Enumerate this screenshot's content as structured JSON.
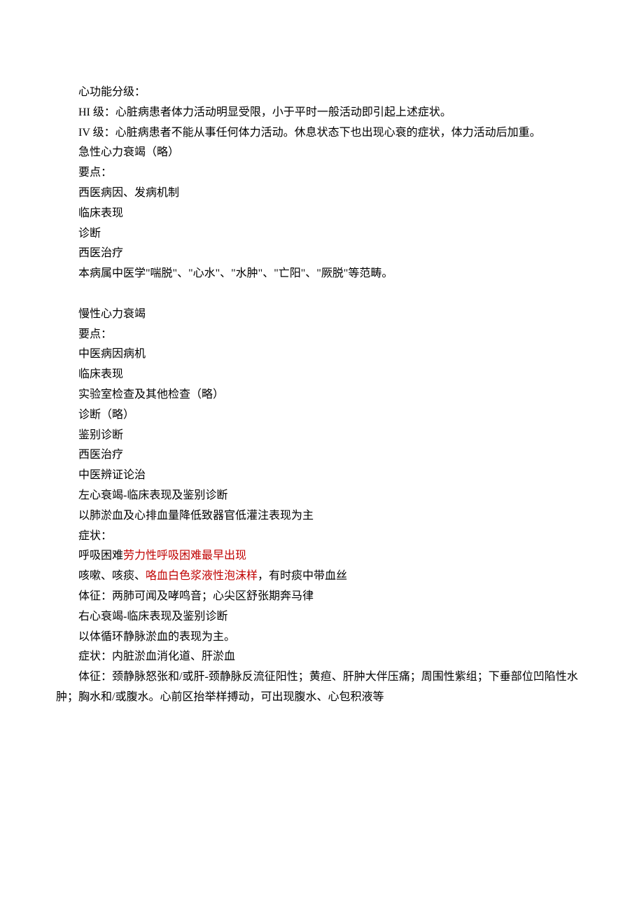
{
  "lines": {
    "l01": "心功能分级：",
    "l02": "HI 级：心脏病患者体力活动明显受限，小于平时一般活动即引起上述症状。",
    "l03": "IV 级：心脏病患者不能从事任何体力活动。休息状态下也出现心衰的症状，体力活动后加重。",
    "l04": "急性心力衰竭（略）",
    "l05": "要点：",
    "l06": "西医病因、发病机制",
    "l07": "临床表现",
    "l08": "诊断",
    "l09": "西医治疗",
    "l10": "本病属中医学\"喘脱\"、\"心水\"、\"水肿\"、\"亡阳\"、\"厥脱\"等范畴。",
    "l11": "慢性心力衰竭",
    "l12": "要点：",
    "l13": "中医病因病机",
    "l14": "临床表现",
    "l15": "实验室检查及其他检查（略）",
    "l16": "诊断（略）",
    "l17": "鉴别诊断",
    "l18": "西医治疗",
    "l19": "中医辨证论治",
    "l20": "左心衰竭-临床表现及鉴别诊断",
    "l21": "以肺淤血及心排血量降低致器官低灌注表现为主",
    "l22": "症状：",
    "l23a": "呼吸困难",
    "l23b": "劳力性呼吸困难最早出现",
    "l24a": "咳嗽、咳痰、",
    "l24b": "咯血白色浆液性泡沫样",
    "l24c": "，有时痰中带血丝",
    "l25": "体征：两肺可闻及哮鸣音；心尖区舒张期奔马律",
    "l26": "右心衰竭-临床表现及鉴别诊断",
    "l27": "以体循环静脉淤血的表现为主。",
    "l28": "症状：内脏淤血消化道、肝淤血",
    "l29": "体征：颈静脉怒张和/或肝-颈静脉反流征阳性；黄疸、肝肿大伴压痛；周围性紫组；下垂部位凹陷性水肿；胸水和/或腹水。心前区抬举样搏动，可出现腹水、心包积液等"
  }
}
